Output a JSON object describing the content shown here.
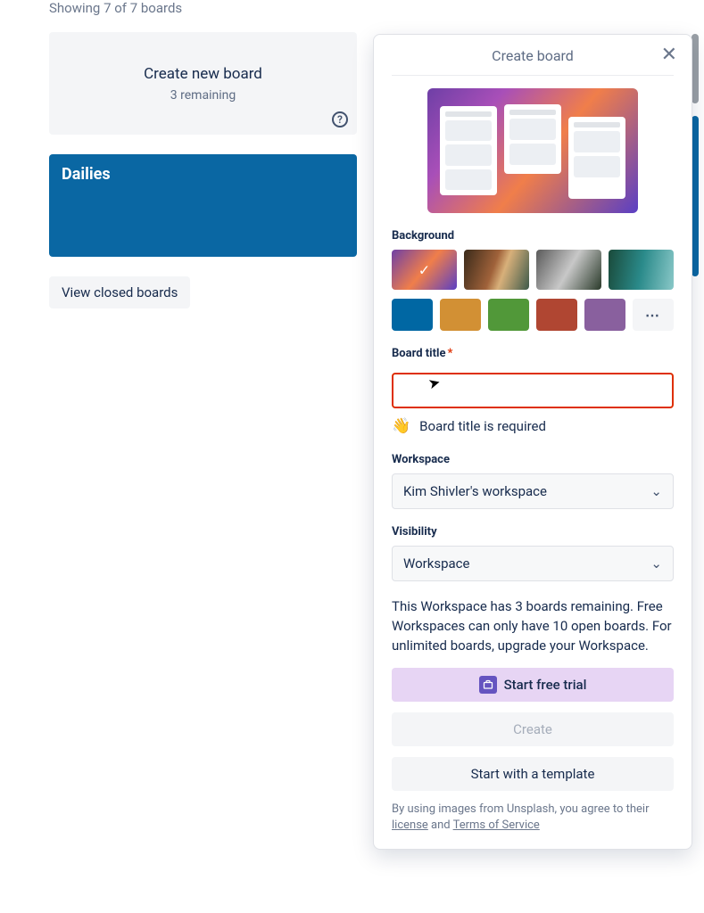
{
  "page": {
    "showing_text": "Showing 7 of 7 boards"
  },
  "tiles": {
    "create": {
      "title": "Create new board",
      "remaining": "3 remaining"
    },
    "board1": {
      "title": "Dailies"
    }
  },
  "closed_button": "View closed boards",
  "popover": {
    "title": "Create board",
    "background_label": "Background",
    "board_title_label": "Board title",
    "board_title_value": "",
    "hint_text": "Board title is required",
    "workspace_label": "Workspace",
    "workspace_value": "Kim Shivler's workspace",
    "visibility_label": "Visibility",
    "visibility_value": "Workspace",
    "info_text": "This Workspace has 3 boards remaining. Free Workspaces can only have 10 open boards. For unlimited boards, upgrade your Workspace.",
    "trial_label": "Start free trial",
    "create_label": "Create",
    "template_label": "Start with a template",
    "footnote_prefix": "By using images from Unsplash, you agree to their ",
    "license_text": "license",
    "and_text": " and ",
    "tos_text": "Terms of Service",
    "more_dots": "⋯",
    "colors": {
      "blue": "#0067a3",
      "orange": "#d29034",
      "green": "#519839",
      "red": "#b04632",
      "purple": "#89609e"
    }
  }
}
